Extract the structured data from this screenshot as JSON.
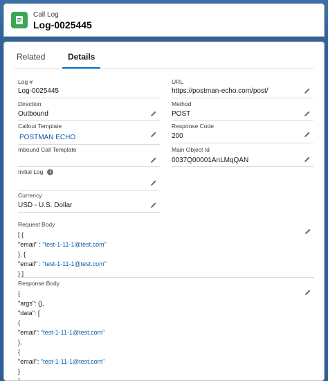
{
  "header": {
    "object_label": "Call Log",
    "record_name": "Log-0025445",
    "icon": "call-log-icon",
    "icon_color": "#3ba755"
  },
  "tabs": [
    {
      "label": "Related",
      "active": false
    },
    {
      "label": "Details",
      "active": true
    }
  ],
  "fields": {
    "log_no": {
      "label": "Log #",
      "value": "Log-0025445"
    },
    "url": {
      "label": "URL",
      "value": "https://postman-echo.com/post/"
    },
    "direction": {
      "label": "Direction",
      "value": "Outbound"
    },
    "method": {
      "label": "Method",
      "value": "POST"
    },
    "callout_template": {
      "label": "Callout Template",
      "value": "POSTMAN ECHO"
    },
    "response_code": {
      "label": "Response Code",
      "value": "200"
    },
    "inbound_call_template": {
      "label": "Inbound Call Template",
      "value": ""
    },
    "main_object_id": {
      "label": "Main Object Id",
      "value": "0037Q00001AnLMqQAN"
    },
    "initial_log": {
      "label": "Initial Log",
      "value": ""
    },
    "currency": {
      "label": "Currency",
      "value": "USD - U.S. Dollar"
    }
  },
  "request_body": {
    "label": "Request Body",
    "lines": [
      {
        "pre": "[ {",
        "str": "",
        "post": ""
      },
      {
        "pre": "\"email\" : ",
        "str": "\"test-1-11-1@test.com\"",
        "post": ""
      },
      {
        "pre": "}, {",
        "str": "",
        "post": ""
      },
      {
        "pre": "\"email\" : ",
        "str": "\"test-1-11-1@test.com\"",
        "post": ""
      },
      {
        "pre": "} ]",
        "str": "",
        "post": ""
      }
    ]
  },
  "response_body": {
    "label": "Response Body",
    "lines": [
      {
        "pre": "{",
        "str": "",
        "post": ""
      },
      {
        "pre": "\"args\": {},",
        "str": "",
        "post": ""
      },
      {
        "pre": "\"data\": [",
        "str": "",
        "post": ""
      },
      {
        "pre": "{",
        "str": "",
        "post": ""
      },
      {
        "pre": "\"email\": ",
        "str": "\"test-1-11-1@test.com\"",
        "post": ""
      },
      {
        "pre": "},",
        "str": "",
        "post": ""
      },
      {
        "pre": "{",
        "str": "",
        "post": ""
      },
      {
        "pre": "\"email\": ",
        "str": "\"test-1-11-1@test.com\"",
        "post": ""
      },
      {
        "pre": "}",
        "str": "",
        "post": ""
      },
      {
        "pre": "],",
        "str": "",
        "post": ""
      }
    ]
  },
  "colors": {
    "link": "#0b5cab",
    "tab_active": "#0176d3"
  }
}
